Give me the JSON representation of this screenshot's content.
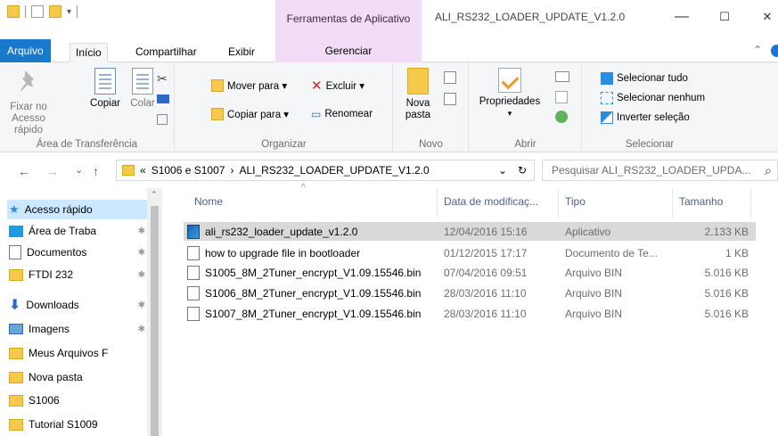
{
  "window": {
    "contextual_group": "Ferramentas de Aplicativo",
    "title": "ALI_RS232_LOADER_UPDATE_V1.2.0",
    "minimize": "—",
    "maximize": "☐",
    "close": "✕"
  },
  "tabs": {
    "arquivo": "Arquivo",
    "inicio": "Início",
    "compartilhar": "Compartilhar",
    "exibir": "Exibir",
    "gerenciar": "Gerenciar"
  },
  "ribbon": {
    "clipboard": {
      "pin_label_1": "Fixar no",
      "pin_label_2": "Acesso rápido",
      "copy": "Copiar",
      "paste": "Colar",
      "label": "Área de Transferência"
    },
    "organize": {
      "move_to": "Mover para ▾",
      "copy_to": "Copiar para ▾",
      "delete": "Excluir ▾",
      "rename": "Renomear",
      "label": "Organizar"
    },
    "new": {
      "new_folder_1": "Nova",
      "new_folder_2": "pasta",
      "label": "Novo"
    },
    "open": {
      "properties": "Propriedades",
      "properties_arrow": "▾",
      "label": "Abrir"
    },
    "select": {
      "select_all": "Selecionar tudo",
      "select_none": "Selecionar nenhum",
      "invert": "Inverter seleção",
      "label": "Selecionar"
    }
  },
  "address": {
    "back": "←",
    "forward": "→",
    "recent": "⌄",
    "up": "↑",
    "path_prefix": "«",
    "crumb1": "S1006 e S1007",
    "sep": "›",
    "crumb2": "ALI_RS232_LOADER_UPDATE_V1.2.0",
    "dropdown": "⌄",
    "refresh": "↻",
    "search_placeholder": "Pesquisar ALI_RS232_LOADER_UPDA...",
    "search_icon": "⌕"
  },
  "navpane": {
    "items": [
      {
        "label": "Acesso rápido",
        "icon": "star-icon",
        "pinned": false
      },
      {
        "label": "Área de Traba",
        "icon": "desktop-icon",
        "pinned": true
      },
      {
        "label": "Documentos",
        "icon": "documents-icon",
        "pinned": true
      },
      {
        "label": "FTDI 232",
        "icon": "folder-icon",
        "pinned": true
      },
      {
        "label": "Downloads",
        "icon": "downloads-icon",
        "pinned": true
      },
      {
        "label": "Imagens",
        "icon": "images-icon",
        "pinned": true
      },
      {
        "label": "Meus Arquivos F",
        "icon": "folder-icon",
        "pinned": false
      },
      {
        "label": "Nova pasta",
        "icon": "folder-icon",
        "pinned": false
      },
      {
        "label": "S1006",
        "icon": "folder-icon",
        "pinned": false
      },
      {
        "label": "Tutorial S1009",
        "icon": "folder-icon",
        "pinned": false
      }
    ],
    "pin_glyph": "✱"
  },
  "filelist": {
    "columns": {
      "name": "Nome",
      "date": "Data de modificaç...",
      "type": "Tipo",
      "size": "Tamanho"
    },
    "sort_indicator": "^",
    "rows": [
      {
        "name": "ali_rs232_loader_update_v1.2.0",
        "date": "12/04/2016 15:16",
        "type": "Aplicativo",
        "size": "2.133 KB"
      },
      {
        "name": "how to upgrade file in bootloader",
        "date": "01/12/2015 17:17",
        "type": "Documento de Te...",
        "size": "1 KB"
      },
      {
        "name": "S1005_8M_2Tuner_encrypt_V1.09.15546.bin",
        "date": "07/04/2016 09:51",
        "type": "Arquivo BIN",
        "size": "5.016 KB"
      },
      {
        "name": "S1006_8M_2Tuner_encrypt_V1.09.15546.bin",
        "date": "28/03/2016 11:10",
        "type": "Arquivo BIN",
        "size": "5.016 KB"
      },
      {
        "name": "S1007_8M_2Tuner_encrypt_V1.09.15546.bin",
        "date": "28/03/2016 11:10",
        "type": "Arquivo BIN",
        "size": "5.016 KB"
      }
    ]
  },
  "colors": {
    "accent": "#1979ca",
    "contextual": "#f3dcf7",
    "selection": "#cce8ff"
  }
}
